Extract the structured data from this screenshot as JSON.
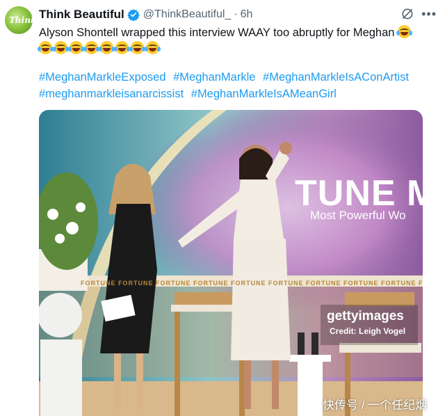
{
  "tweet": {
    "author_name": "Think Beautiful",
    "author_handle": "@ThinkBeautiful_",
    "separator": "·",
    "time": "6h",
    "avatar_text": "Think",
    "text": "Alyson Shontell wrapped this interview WAAY too abruptly for Meghan",
    "emoji_count_line1": 1,
    "emoji_count_line2": 8,
    "emoji_name": "face-with-tears-of-joy",
    "hashtags": [
      "#MeghanMarkleExposed",
      "#MeghanMarkle",
      "#MeghanMarkleIsAConArtist",
      "#meghanmarkleisanarcissist",
      "#MeghanMarkleIsAMeanGirl"
    ]
  },
  "media": {
    "stage_title": "TUNE M",
    "stage_subtitle": "Most Powerful Wo",
    "stage_strip": "FORTUNE  FORTUNE  FORTUNE  FORTUNE  FORTUNE  FORTUNE  FORTUNE  FORTUNE  FORTUNE  FORTUNE",
    "getty_logo": "gettyimages",
    "getty_credit": "Credit: Leigh Vogel"
  },
  "watermark": "快传号 / 一个任纪烟",
  "colors": {
    "link": "#1d9bf0",
    "verified": "#1d9bf0",
    "secondary_text": "#536471"
  },
  "icons": [
    "verified-badge-icon",
    "grok-icon",
    "more-options-icon"
  ]
}
